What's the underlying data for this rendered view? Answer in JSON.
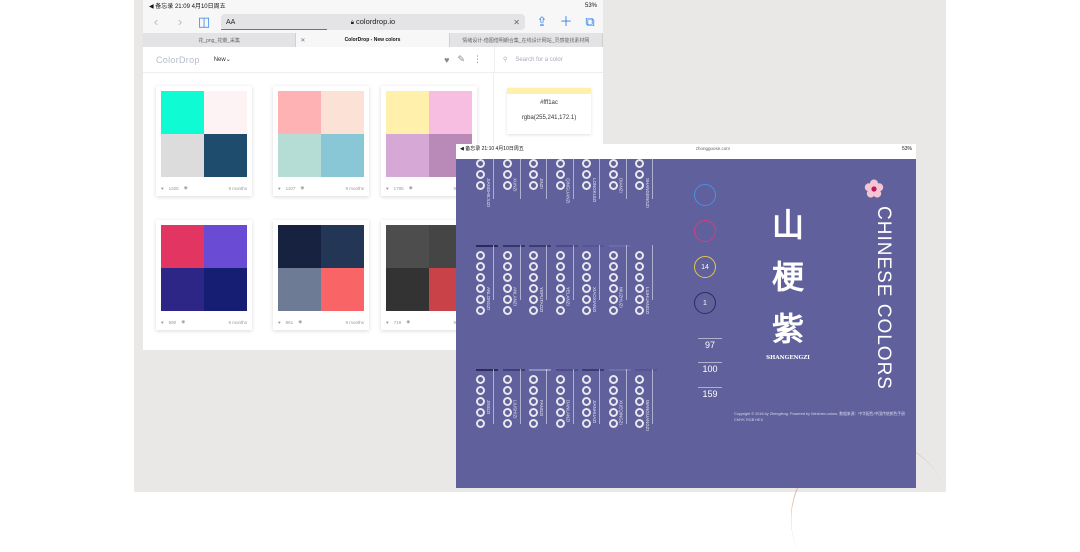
{
  "screen1": {
    "status": {
      "left": "◀ 备忘录 21:09 4月10日周五",
      "right": "53%"
    },
    "address": {
      "aa": "AA",
      "url": "colordrop.io"
    },
    "tabs": [
      {
        "label": "花_png_花瓣_采集",
        "active": false
      },
      {
        "label": "ColorDrop - New colors",
        "active": true
      },
      {
        "label": "情绪设计-借图借明朗合集_在线设计网站_灵感能找素材网",
        "active": false
      }
    ],
    "app": {
      "logo": "ColorDrop",
      "sort": "New",
      "search_placeholder": "Search for a color"
    },
    "selected_color": {
      "hex": "#fff1ac",
      "rgba": "rgba(255,241,172.1)"
    },
    "palettes": [
      {
        "colors": [
          "#0ffbd3",
          "#fdf3f4",
          "#dcdcdc",
          "#1e4c6c"
        ],
        "likes": "1325",
        "time": "9 months"
      },
      {
        "colors": [
          "#feb2b4",
          "#fce1d7",
          "#b5ddd5",
          "#8ac7d6"
        ],
        "likes": "1107",
        "time": "9 months"
      },
      {
        "colors": [
          "#fff1ac",
          "#f7bee1",
          "#d5a8d5",
          "#b98ab8"
        ],
        "likes": "1795",
        "time": "9 months"
      },
      {
        "colors": [
          "#e33562",
          "#6a4bd4",
          "#2d2687",
          "#161e74"
        ],
        "likes": "690",
        "time": "9 months"
      },
      {
        "colors": [
          "#172240",
          "#233656",
          "#6e7b94",
          "#f96566"
        ],
        "likes": "861",
        "time": "9 months"
      },
      {
        "colors": [
          "#4d4d4d",
          "#454545",
          "#333333",
          "#c94248"
        ],
        "likes": "719",
        "time": "9 months"
      }
    ]
  },
  "screen2": {
    "status": {
      "left": "◀ 备忘录 21:10 4月10日周五",
      "center": "zhongguose.com",
      "right": "53%"
    },
    "title_hanzi": [
      "山",
      "梗",
      "紫"
    ],
    "pinyin": "SHANGENGZI",
    "side_title": "CHINESE COLORS",
    "indicators": [
      "",
      "",
      "14",
      "1"
    ],
    "numbers": [
      "97",
      "100",
      "159"
    ],
    "copyright": "Copyright © 2016 by Zhengfeng. Powered by Weichen-colors. 数据来源：中华配色/中国传统颜色手册 CMYK RGB HEX",
    "columns_top": [
      {
        "name": "JIANGHEJUZI",
        "bar": "#3b3c6b"
      },
      {
        "name": "XUNZI",
        "bar": "#45467a"
      },
      {
        "name": "JINZI",
        "bar": "#44457a"
      },
      {
        "name": "QINGLIANZI",
        "bar": "#5a5c9a"
      },
      {
        "name": "LONGKUIZI",
        "bar": "#2f3160"
      },
      {
        "name": "DIANZI",
        "bar": "#8889b8"
      },
      {
        "name": "SHANGENGZI",
        "bar": "#6162a0"
      }
    ],
    "columns_mid": [
      {
        "name": "ANLONGZI",
        "bar": "#2a2b58"
      },
      {
        "name": "ANLANZI",
        "bar": "#35366b"
      },
      {
        "name": "YEPUTAOZI",
        "bar": "#3c3d6f"
      },
      {
        "name": "YELANZI",
        "bar": "#4a4b86"
      },
      {
        "name": "XIAOXIANZI",
        "bar": "#55569a"
      },
      {
        "name": "WUZHUZI",
        "bar": "#6a6ba8"
      },
      {
        "name": "LIUHUANGZI",
        "bar": "#5f609c"
      }
    ],
    "columns_bottom": [
      {
        "name": "JINGZI",
        "bar": "#2b2c59"
      },
      {
        "name": "LIUSHIZI",
        "bar": "#3d3e7a"
      },
      {
        "name": "FANGZI",
        "bar": "#8e8fbd"
      },
      {
        "name": "DANLANZI",
        "bar": "#4c4d88"
      },
      {
        "name": "JIANHUAZI",
        "bar": "#3a3b70"
      },
      {
        "name": "XUEQINGZI",
        "bar": "#7071a8"
      },
      {
        "name": "WANGUANGZI",
        "bar": "#55568f"
      }
    ]
  }
}
